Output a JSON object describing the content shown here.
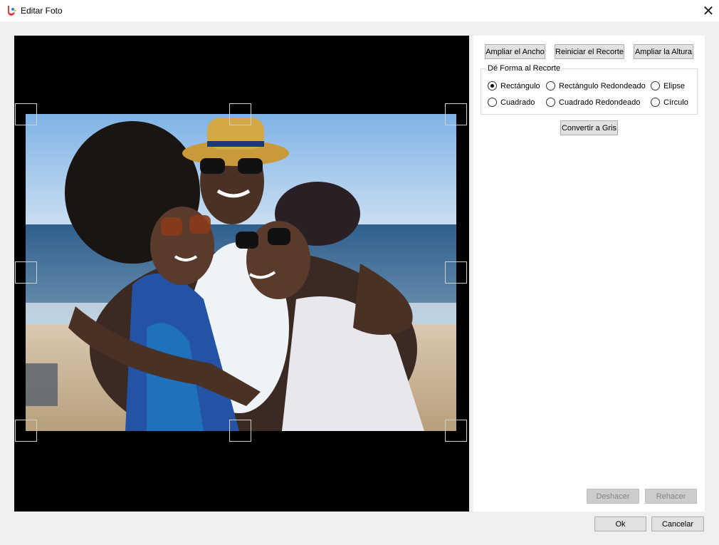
{
  "window": {
    "title": "Editar Foto",
    "close_glyph": "✕"
  },
  "toolbar": {
    "widen_label": "Ampliar el Ancho",
    "reset_crop_label": "Reiniciar el Recorte",
    "heighten_label": "Ampliar la Altura"
  },
  "crop_shape": {
    "legend": "Dé Forma al Recorte",
    "options": [
      {
        "label": "Rectángulo",
        "selected": true
      },
      {
        "label": "Rectángulo Redondeado",
        "selected": false
      },
      {
        "label": "Elipse",
        "selected": false
      },
      {
        "label": "Cuadrado",
        "selected": false
      },
      {
        "label": "Cuadrado Redondeado",
        "selected": false
      },
      {
        "label": "Círculo",
        "selected": false
      }
    ]
  },
  "grayscale_label": "Convertir a Gris",
  "history": {
    "undo_label": "Deshacer",
    "redo_label": "Rehacer"
  },
  "footer": {
    "ok_label": "Ok",
    "cancel_label": "Cancelar"
  },
  "icons": {
    "app": "app-logo-icon",
    "close": "close-icon"
  }
}
